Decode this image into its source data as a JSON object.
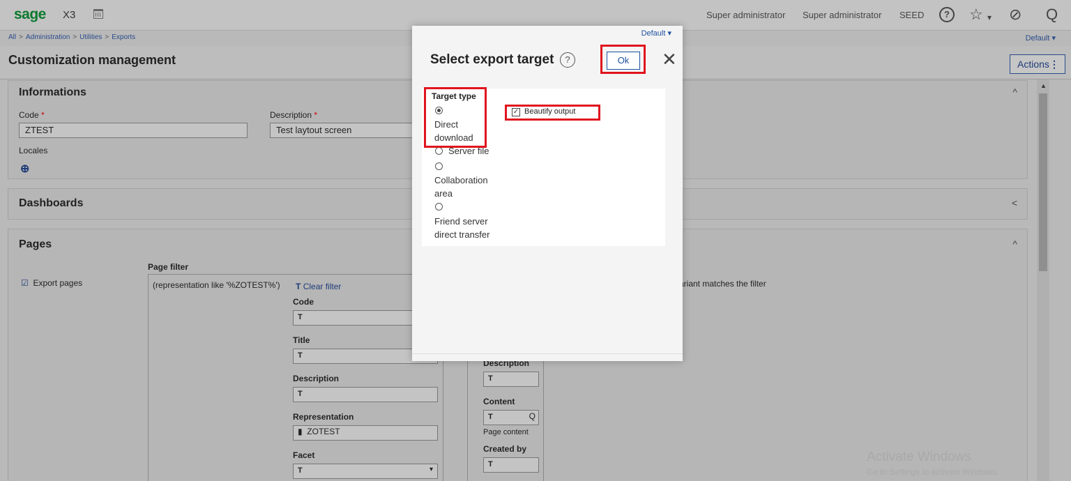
{
  "topbar": {
    "logo": "sage",
    "app": "X3",
    "user1": "Super administrator",
    "user2": "Super administrator",
    "folder": "SEED",
    "help": "?",
    "star": "☆",
    "star_caret": "▾",
    "compass": "⊘",
    "search": "Q"
  },
  "breadcrumb": {
    "items": [
      "All",
      "Administration",
      "Utilities",
      "Exports"
    ],
    "sep": ">"
  },
  "default_right": "Default ▾",
  "page": {
    "title": "Customization management",
    "actions_label": "Actions",
    "actions_dots": "⋮"
  },
  "informations": {
    "title": "Informations",
    "code_label": "Code",
    "code_value": "ZTEST",
    "description_label": "Description",
    "description_value": "Test laytout screen",
    "locales_label": "Locales",
    "required": "*",
    "zoom_glyph": "⊕",
    "chevron": "^"
  },
  "dashboards": {
    "title": "Dashboards",
    "chevron": "<"
  },
  "pages": {
    "title": "Pages",
    "chevron": "^",
    "export_pages_label": "Export pages",
    "page_filter_label": "Page filter",
    "filter_expression": "(representation like '%ZOTEST%')",
    "clear_filter": "Clear filter",
    "clear_filter_icon": "T",
    "variant_note": "ariant matches the filter",
    "filter_icon": "T",
    "checkbox_glyph": "☑",
    "search_glyph": "Q",
    "dropdown_caret": "▾",
    "rep_icon": "▮",
    "col1": {
      "code": "Code",
      "title": "Title",
      "description": "Description",
      "representation": "Representation",
      "representation_value": "ZOTEST",
      "facet": "Facet"
    },
    "col2": {
      "description": "Description",
      "content": "Content",
      "page_content": "Page content",
      "created_by": "Created by"
    }
  },
  "watermark": {
    "line1": "Activate Windows",
    "line2": "Go to Settings to activate Windows."
  },
  "modal": {
    "default_label": "Default ▾",
    "title": "Select export target",
    "help": "?",
    "ok_label": "Ok",
    "close": "✕",
    "target_type_label": "Target type",
    "options": [
      {
        "line1": "Direct",
        "line2": "download",
        "selected": true
      },
      {
        "line1": "Server file",
        "line2": "",
        "selected": false
      },
      {
        "line1": "Collaboration",
        "line2": "area",
        "selected": false
      },
      {
        "line1": "Friend server",
        "line2": "direct transfer",
        "selected": false
      }
    ],
    "beautify_label": "Beautify output",
    "beautify_checked": true
  },
  "colors": {
    "highlight": "#e0141e",
    "link": "#1d4fa0",
    "brand": "#0a7a2d"
  }
}
